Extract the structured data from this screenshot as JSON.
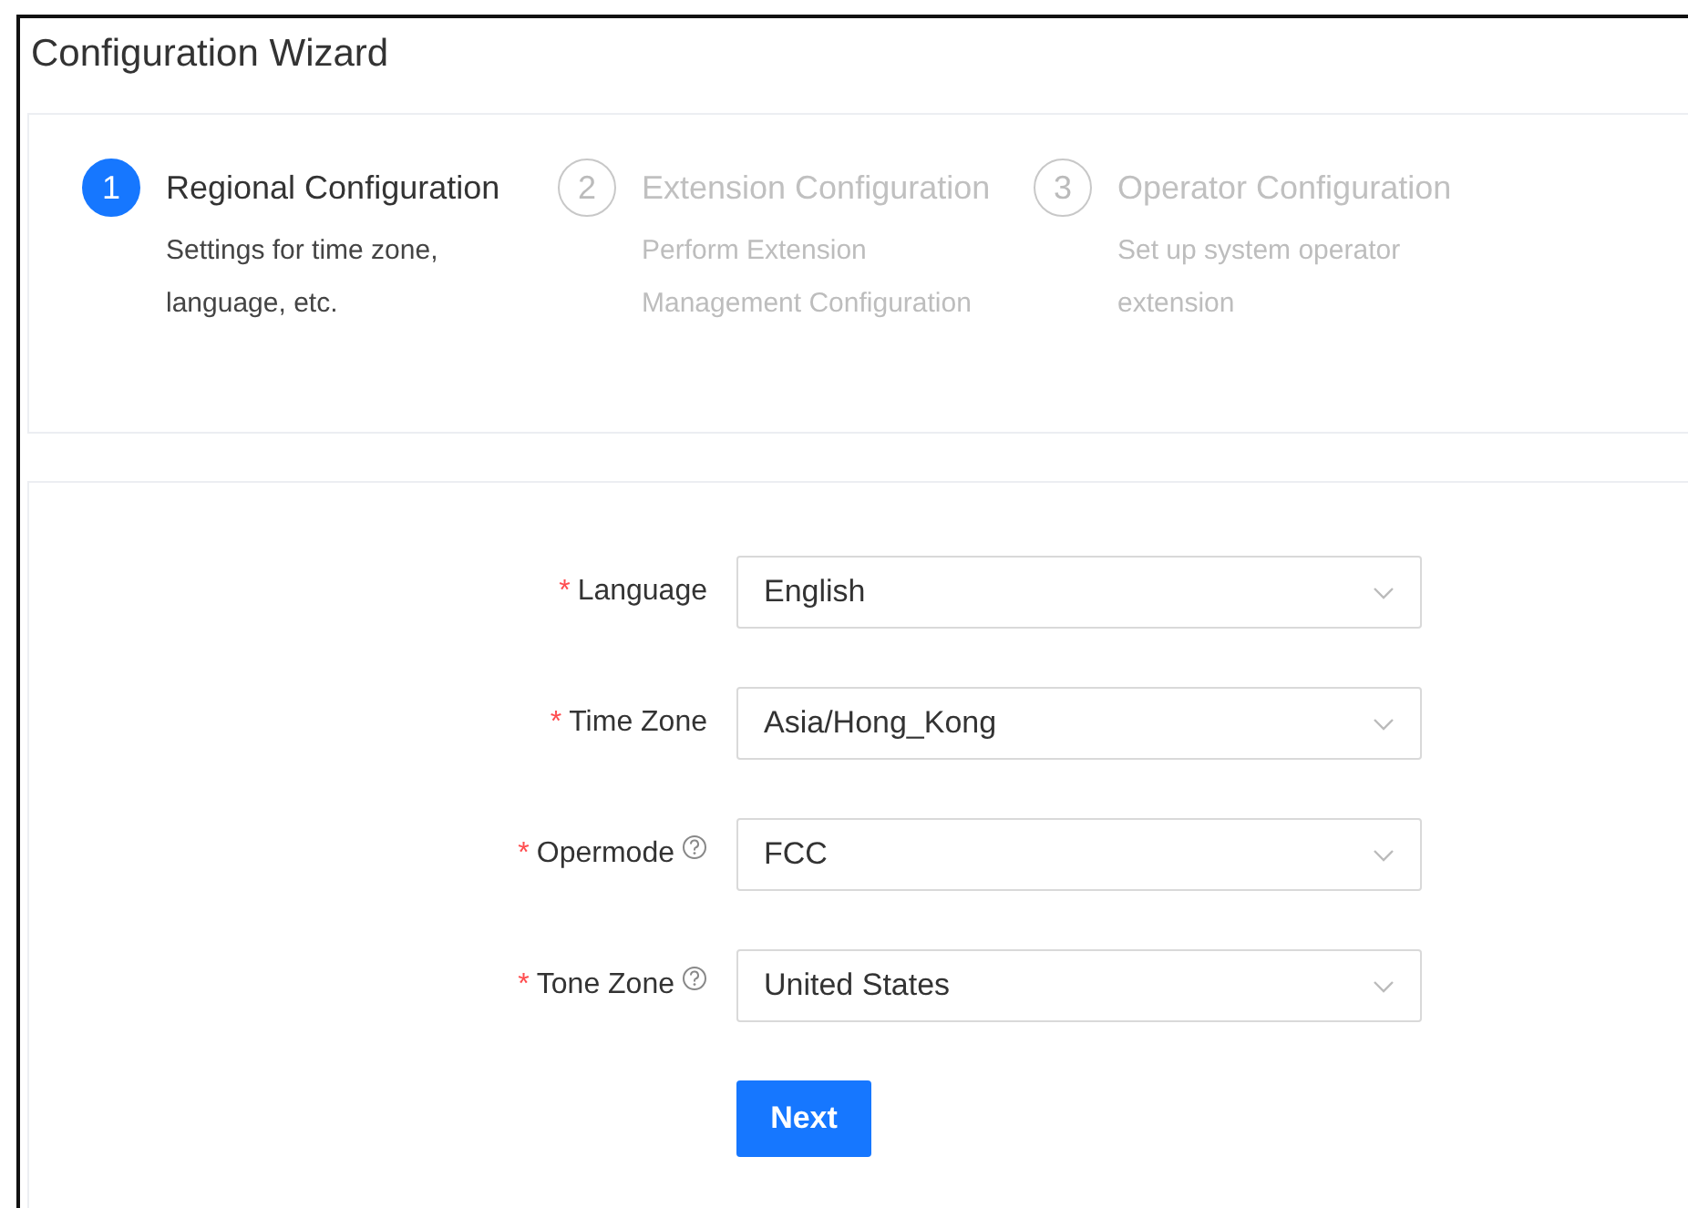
{
  "window": {
    "title": "Configuration Wizard"
  },
  "steps": [
    {
      "number": "1",
      "title": "Regional Configuration",
      "description": "Settings for time zone, language, etc.",
      "active": true
    },
    {
      "number": "2",
      "title": "Extension Configuration",
      "description": "Perform Extension Management Configuration",
      "active": false
    },
    {
      "number": "3",
      "title": "Operator Configuration",
      "description": "Set up system operator extension",
      "active": false
    }
  ],
  "form": {
    "fields": [
      {
        "mark": "*",
        "label": "Language",
        "help": false,
        "value": "English"
      },
      {
        "mark": "*",
        "label": "Time Zone",
        "help": false,
        "value": "Asia/Hong_Kong"
      },
      {
        "mark": "*",
        "label": "Opermode",
        "help": true,
        "value": "FCC"
      },
      {
        "mark": "*",
        "label": "Tone Zone",
        "help": true,
        "value": "United States"
      }
    ],
    "submit": "Next"
  }
}
